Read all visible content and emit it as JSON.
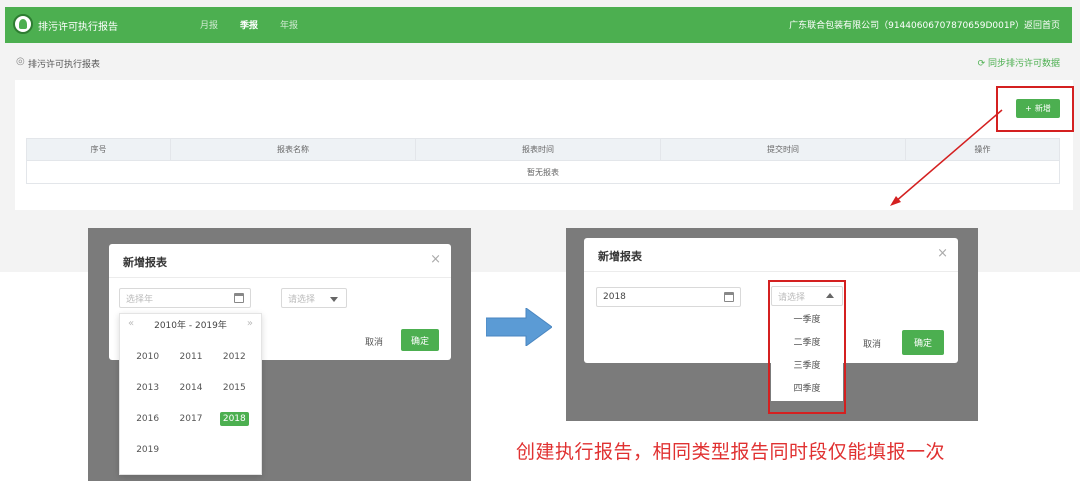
{
  "header": {
    "app_title": "排污许可执行报告",
    "nav": [
      "月报",
      "季报",
      "年报"
    ],
    "company": "广东联合包装有限公司（91440606707870659D001P）返回首页"
  },
  "breadcrumb": {
    "pin_icon": "◎",
    "label": "排污许可执行报表"
  },
  "sync_link": "⟳ 同步排污许可数据",
  "add_button": {
    "icon": "+",
    "label": "新增"
  },
  "table": {
    "columns": [
      "序号",
      "报表名称",
      "报表时间",
      "提交时间",
      "操作"
    ],
    "empty_text": "暂无报表"
  },
  "dialog_left": {
    "title": "新增报表",
    "close": "×",
    "year_placeholder": "选择年",
    "type_placeholder": "请选择",
    "cancel": "取消",
    "ok": "确定",
    "year_panel": {
      "prev": "«",
      "next": "»",
      "range": "2010年 - 2019年",
      "years": [
        "2010",
        "2011",
        "2012",
        "2013",
        "2014",
        "2015",
        "2016",
        "2017",
        "2018",
        "2019"
      ],
      "selected": "2018"
    }
  },
  "dialog_right": {
    "title": "新增报表",
    "close": "×",
    "year_value": "2018",
    "type_placeholder": "请选择",
    "cancel": "取消",
    "ok": "确定",
    "options": [
      "一季度",
      "二季度",
      "三季度",
      "四季度"
    ]
  },
  "caption": "创建执行报告，相同类型报告同时段仅能填报一次",
  "colors": {
    "primary": "#4caf50",
    "highlight": "#d42020",
    "arrow": "#5b9bd5"
  }
}
